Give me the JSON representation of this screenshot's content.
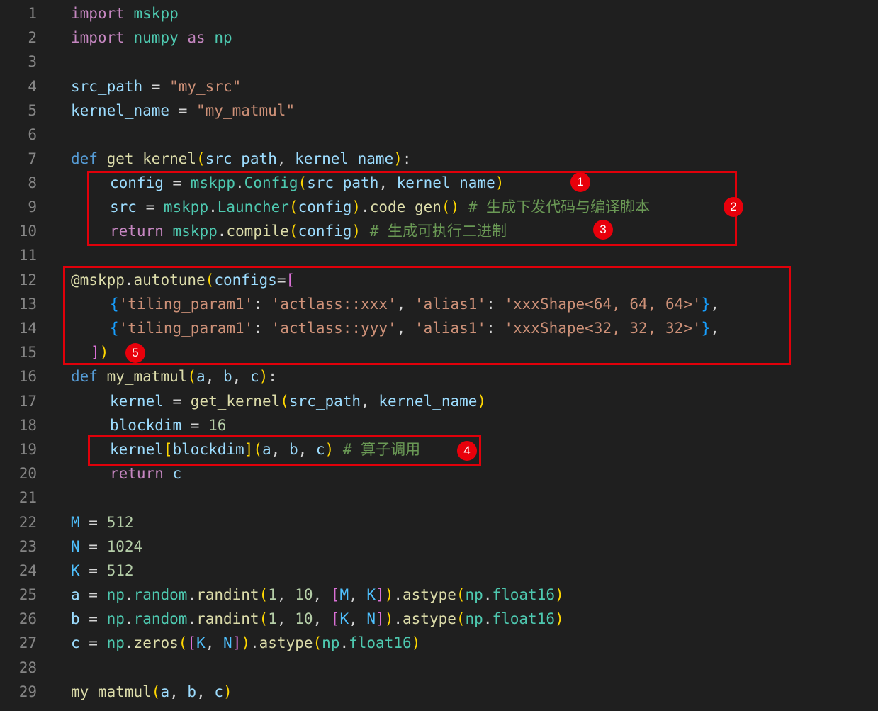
{
  "editor": {
    "line_numbers": [
      "1",
      "2",
      "3",
      "4",
      "5",
      "6",
      "7",
      "8",
      "9",
      "10",
      "11",
      "12",
      "13",
      "14",
      "15",
      "16",
      "17",
      "18",
      "19",
      "20",
      "21",
      "22",
      "23",
      "24",
      "25",
      "26",
      "27",
      "28",
      "29"
    ],
    "code": {
      "l1": [
        "import",
        " ",
        "mskpp"
      ],
      "l2": [
        "import",
        " ",
        "numpy",
        " ",
        "as",
        " ",
        "np"
      ],
      "l4": [
        "src_path",
        " = ",
        "\"my_src\""
      ],
      "l5": [
        "kernel_name",
        " = ",
        "\"my_matmul\""
      ],
      "l7": [
        "def",
        " ",
        "get_kernel",
        "(",
        "src_path",
        ", ",
        "kernel_name",
        ")",
        ":"
      ],
      "l8": [
        "config",
        " = ",
        "mskpp",
        ".",
        "Config",
        "(",
        "src_path",
        ", ",
        "kernel_name",
        ")"
      ],
      "l9": [
        "src",
        " = ",
        "mskpp",
        ".",
        "Launcher",
        "(",
        "config",
        ")",
        ".",
        "code_gen",
        "(",
        ")",
        " ",
        "# 生成下发代码与编译脚本"
      ],
      "l10": [
        "return",
        " ",
        "mskpp",
        ".",
        "compile",
        "(",
        "config",
        ")",
        " ",
        "# 生成可执行二进制"
      ],
      "l12": [
        "@mskpp",
        ".",
        "autotune",
        "(",
        "configs",
        "=",
        "["
      ],
      "l13": [
        "{",
        "'tiling_param1'",
        ": ",
        "'actlass::xxx'",
        ", ",
        "'alias1'",
        ": ",
        "'xxxShape<64, 64, 64>'",
        "}",
        ","
      ],
      "l14": [
        "{",
        "'tiling_param1'",
        ": ",
        "'actlass::yyy'",
        ", ",
        "'alias1'",
        ": ",
        "'xxxShape<32, 32, 32>'",
        "}",
        ","
      ],
      "l15": [
        "]",
        ")"
      ],
      "l16": [
        "def",
        " ",
        "my_matmul",
        "(",
        "a",
        ", ",
        "b",
        ", ",
        "c",
        ")",
        ":"
      ],
      "l17": [
        "kernel",
        " = ",
        "get_kernel",
        "(",
        "src_path",
        ", ",
        "kernel_name",
        ")"
      ],
      "l18": [
        "blockdim",
        " = ",
        "16"
      ],
      "l19": [
        "kernel",
        "[",
        "blockdim",
        "]",
        "(",
        "a",
        ", ",
        "b",
        ", ",
        "c",
        ")",
        " ",
        "# 算子调用"
      ],
      "l20": [
        "return",
        " ",
        "c"
      ],
      "l22": [
        "M",
        " = ",
        "512"
      ],
      "l23": [
        "N",
        " = ",
        "1024"
      ],
      "l24": [
        "K",
        " = ",
        "512"
      ],
      "l25": [
        "a",
        " = ",
        "np",
        ".",
        "random",
        ".",
        "randint",
        "(",
        "1",
        ", ",
        "10",
        ", ",
        "[",
        "M",
        ", ",
        "K",
        "]",
        ")",
        ".",
        "astype",
        "(",
        "np",
        ".",
        "float16",
        ")"
      ],
      "l26": [
        "b",
        " = ",
        "np",
        ".",
        "random",
        ".",
        "randint",
        "(",
        "1",
        ", ",
        "10",
        ", ",
        "[",
        "K",
        ", ",
        "N",
        "]",
        ")",
        ".",
        "astype",
        "(",
        "np",
        ".",
        "float16",
        ")"
      ],
      "l27": [
        "c",
        " = ",
        "np",
        ".",
        "zeros",
        "(",
        "[",
        "K",
        ", ",
        "N",
        "]",
        ")",
        ".",
        "astype",
        "(",
        "np",
        ".",
        "float16",
        ")"
      ],
      "l29": [
        "my_matmul",
        "(",
        "a",
        ", ",
        "b",
        ", ",
        "c",
        ")"
      ]
    }
  },
  "annotations": {
    "badges": [
      "1",
      "2",
      "3",
      "4",
      "5"
    ]
  },
  "colors": {
    "background": "#1f1f1f",
    "annotation_red": "#e0000a"
  }
}
